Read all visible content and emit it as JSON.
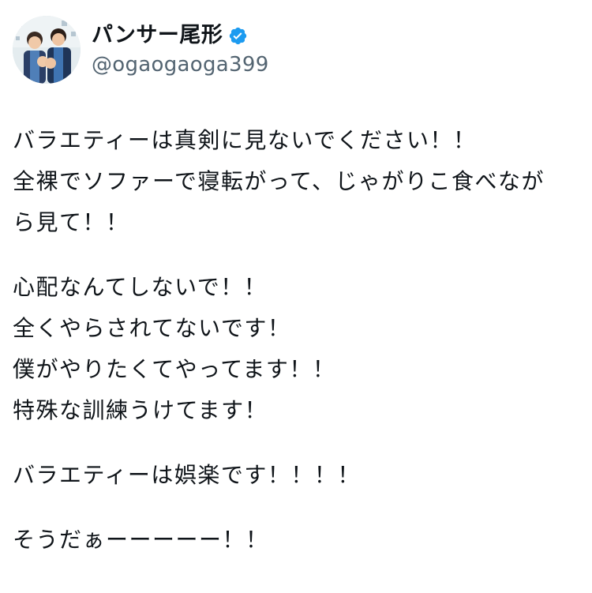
{
  "author": {
    "display_name": "パンサー尾形",
    "handle": "@ogaogaoga399",
    "verified": true,
    "avatar_icon": "profile-photo",
    "verified_color": "#1d9bf0"
  },
  "tweet": {
    "paragraphs": [
      [
        "バラエティーは真剣に見ないでください！！",
        "全裸でソファーで寝転がって、じゃがりこ食べなが",
        "ら見て！！"
      ],
      [
        "心配なんてしないで！！",
        "全くやらされてないです！",
        "僕がやりたくてやってます！！",
        "特殊な訓練うけてます！"
      ],
      [
        "バラエティーは娯楽です！！！！"
      ],
      [
        "そうだぁーーーーー！！"
      ]
    ]
  }
}
